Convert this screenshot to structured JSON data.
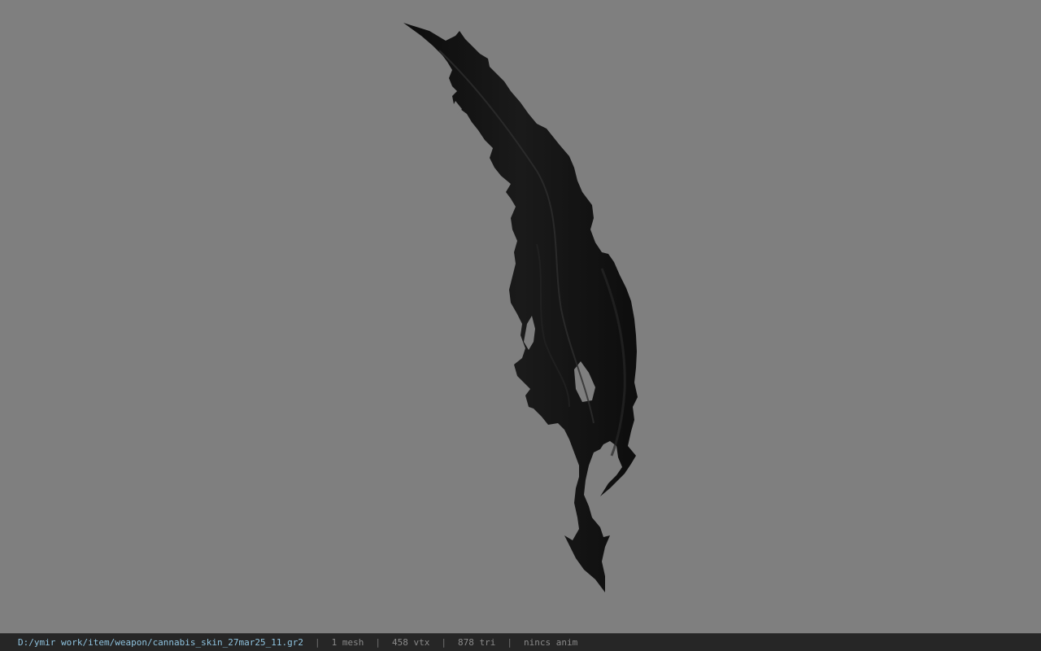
{
  "viewer": {
    "background_color": "#7f7f7f",
    "model_color": "#111111",
    "model_highlight_color": "#2b2b2b"
  },
  "status": {
    "file_path": "D:/ymir work/item/weapon/cannabis_skin_27mar25_11.gr2",
    "separator": "|",
    "mesh_count": "1 mesh",
    "vertex_count": "458 vtx",
    "triangle_count": "878 tri",
    "animation": "nincs anim",
    "path_color": "#8fc3df",
    "text_color": "#8a8a8a"
  }
}
